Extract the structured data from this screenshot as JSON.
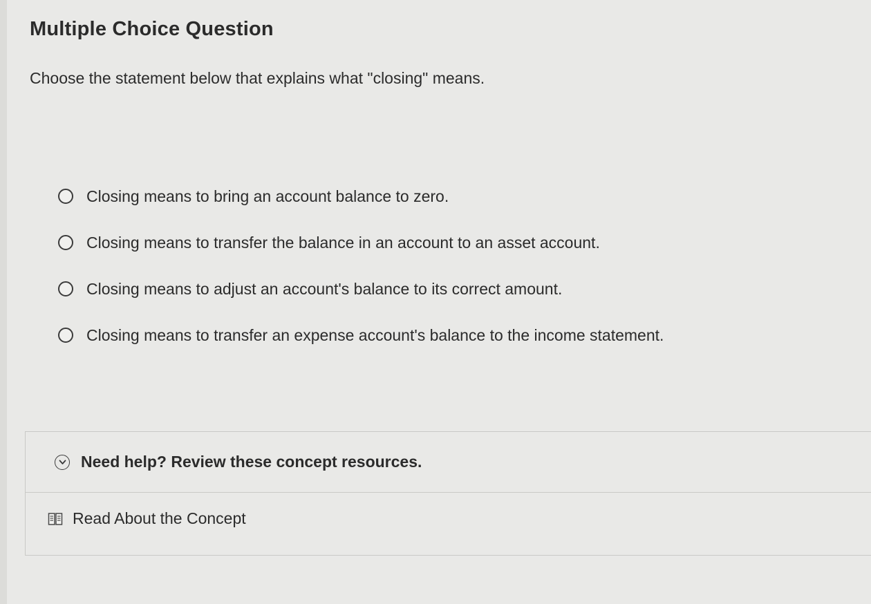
{
  "question": {
    "heading": "Multiple Choice Question",
    "prompt": "Choose the statement below that explains what \"closing\" means."
  },
  "options": [
    {
      "label": "Closing means to bring an account balance to zero.",
      "selected": false
    },
    {
      "label": "Closing means to transfer the balance in an account to an asset account.",
      "selected": false
    },
    {
      "label": "Closing means to adjust an account's balance to its correct amount.",
      "selected": false
    },
    {
      "label": "Closing means to transfer an expense account's balance to the income statement.",
      "selected": false
    }
  ],
  "help": {
    "title": "Need help? Review these concept resources.",
    "icon": "chevron-down-icon",
    "resources": [
      {
        "label": "Read About the Concept",
        "icon": "book-icon"
      }
    ]
  }
}
